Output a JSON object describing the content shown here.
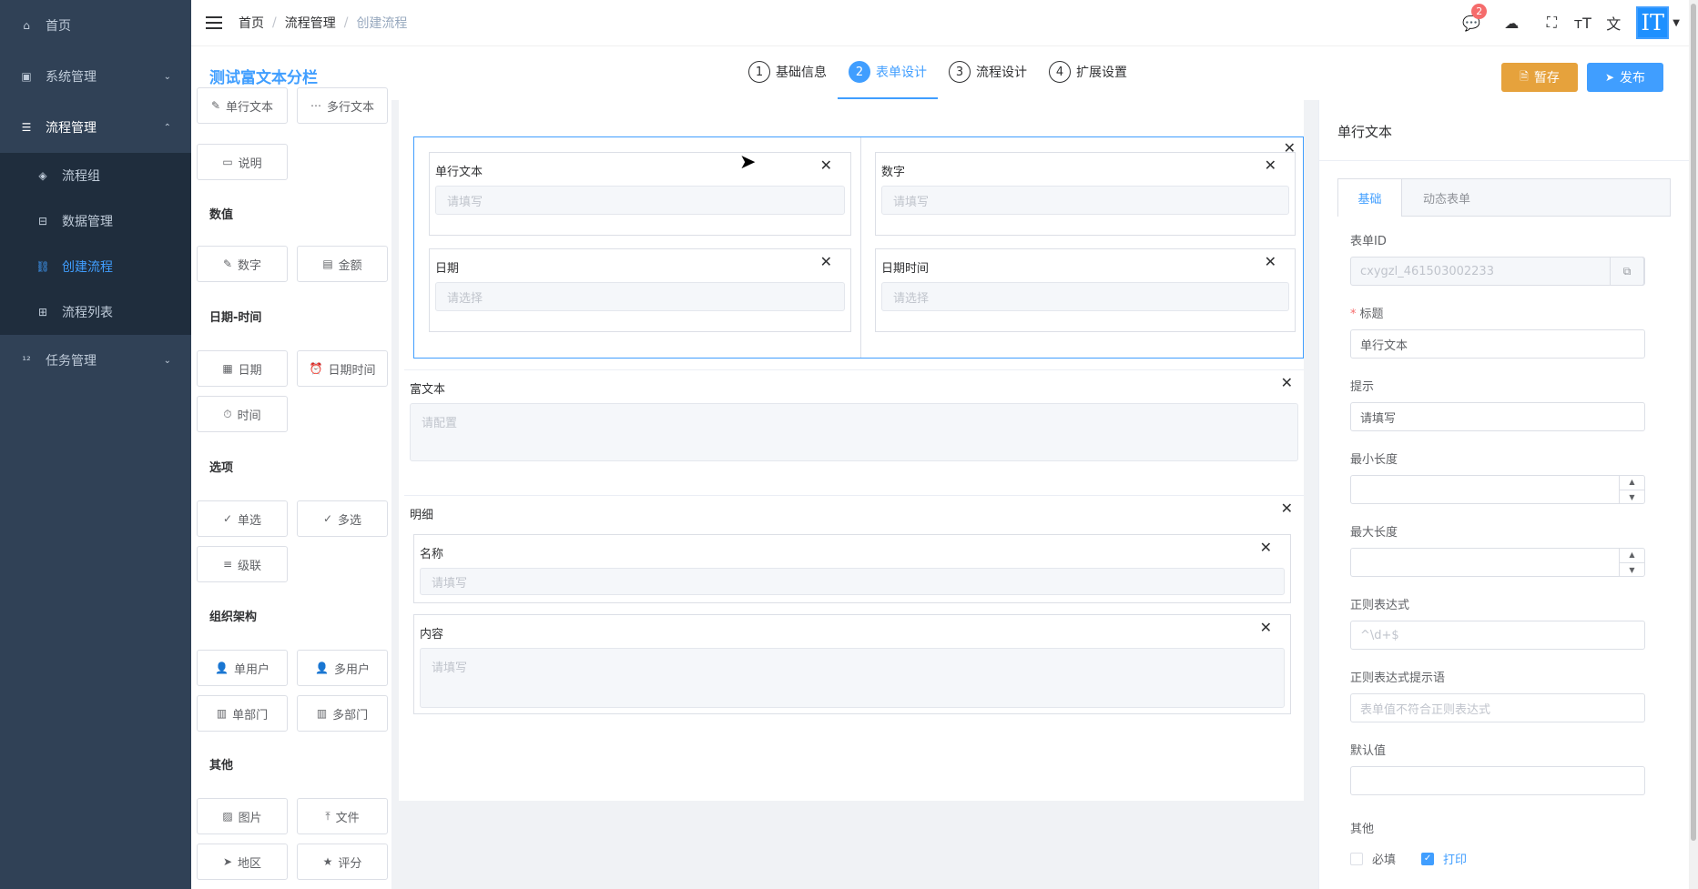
{
  "sidebar": {
    "items": [
      {
        "label": "首页",
        "icon": "home-icon"
      },
      {
        "label": "系统管理",
        "icon": "system-icon"
      },
      {
        "label": "流程管理",
        "icon": "process-icon"
      },
      {
        "label": "任务管理",
        "icon": "task-icon"
      }
    ],
    "sub": [
      {
        "label": "流程组",
        "icon": "layers-icon"
      },
      {
        "label": "数据管理",
        "icon": "data-icon"
      },
      {
        "label": "创建流程",
        "icon": "create-icon"
      },
      {
        "label": "流程列表",
        "icon": "list-icon"
      }
    ]
  },
  "breadcrumb": {
    "items": [
      "首页",
      "流程管理",
      "创建流程"
    ],
    "sep": "/"
  },
  "topbar": {
    "badge_count": "2",
    "avatar_text": "IT"
  },
  "header": {
    "form_title": "测试富文本分栏",
    "steps": [
      {
        "num": "1",
        "label": "基础信息"
      },
      {
        "num": "2",
        "label": "表单设计"
      },
      {
        "num": "3",
        "label": "流程设计"
      },
      {
        "num": "4",
        "label": "扩展设置"
      }
    ],
    "save_label": "暂存",
    "publish_label": "发布"
  },
  "palette": {
    "single_text": "单行文本",
    "multi_text": "多行文本",
    "desc": "说明",
    "group_number": "数值",
    "number": "数字",
    "amount": "金额",
    "group_datetime": "日期-时间",
    "date": "日期",
    "datetime": "日期时间",
    "time": "时间",
    "group_options": "选项",
    "radio": "单选",
    "checkbox": "多选",
    "cascade": "级联",
    "group_org": "组织架构",
    "single_user": "单用户",
    "multi_user": "多用户",
    "single_dept": "单部门",
    "multi_dept": "多部门",
    "group_other": "其他",
    "image": "图片",
    "file": "文件",
    "region": "地区",
    "rating": "评分"
  },
  "canvas": {
    "fields": {
      "single_text": {
        "label": "单行文本",
        "placeholder": "请填写"
      },
      "number": {
        "label": "数字",
        "placeholder": "请填写"
      },
      "date": {
        "label": "日期",
        "placeholder": "请选择"
      },
      "datetime": {
        "label": "日期时间",
        "placeholder": "请选择"
      }
    },
    "rich_text": {
      "label": "富文本",
      "placeholder": "请配置"
    },
    "detail": {
      "label": "明细",
      "name": {
        "label": "名称",
        "placeholder": "请填写"
      },
      "content": {
        "label": "内容",
        "placeholder": "请填写"
      }
    },
    "close_glyph": "✕"
  },
  "props": {
    "title": "单行文本",
    "tabs": [
      "基础",
      "动态表单"
    ],
    "form_id_label": "表单ID",
    "form_id_value": "cxygzl_461503002233",
    "title_label": "标题",
    "title_value": "单行文本",
    "hint_label": "提示",
    "hint_value": "请填写",
    "min_len_label": "最小长度",
    "max_len_label": "最大长度",
    "regex_label": "正则表达式",
    "regex_placeholder": "^\\d+$",
    "regex_hint_label": "正则表达式提示语",
    "regex_hint_placeholder": "表单值不符合正则表达式",
    "default_label": "默认值",
    "other_label": "其他",
    "required_label": "必填",
    "print_label": "打印"
  }
}
